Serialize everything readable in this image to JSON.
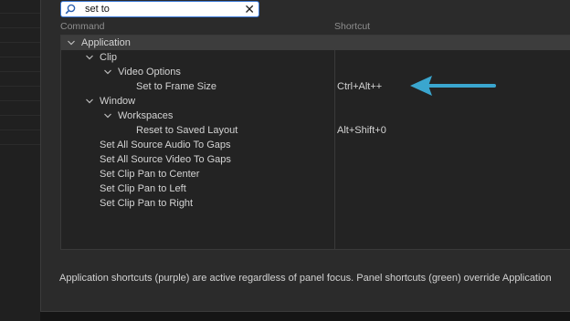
{
  "search": {
    "value": "set to",
    "placeholder": ""
  },
  "columns": {
    "command": "Command",
    "shortcut": "Shortcut"
  },
  "tree": [
    {
      "label": "Application",
      "shortcut": "",
      "depth": 0,
      "expandable": true,
      "selected": true
    },
    {
      "label": "Clip",
      "shortcut": "",
      "depth": 1,
      "expandable": true
    },
    {
      "label": "Video Options",
      "shortcut": "",
      "depth": 2,
      "expandable": true
    },
    {
      "label": "Set to Frame Size",
      "shortcut": "Ctrl+Alt++",
      "depth": 3,
      "expandable": false
    },
    {
      "label": "Window",
      "shortcut": "",
      "depth": 1,
      "expandable": true
    },
    {
      "label": "Workspaces",
      "shortcut": "",
      "depth": 2,
      "expandable": true
    },
    {
      "label": "Reset to Saved Layout",
      "shortcut": "Alt+Shift+0",
      "depth": 3,
      "expandable": false
    },
    {
      "label": "Set All Source Audio To Gaps",
      "shortcut": "",
      "depth": 1,
      "expandable": false
    },
    {
      "label": "Set All Source Video To Gaps",
      "shortcut": "",
      "depth": 1,
      "expandable": false
    },
    {
      "label": "Set Clip Pan to Center",
      "shortcut": "",
      "depth": 1,
      "expandable": false
    },
    {
      "label": "Set Clip Pan to Left",
      "shortcut": "",
      "depth": 1,
      "expandable": false
    },
    {
      "label": "Set Clip Pan to Right",
      "shortcut": "",
      "depth": 1,
      "expandable": false
    }
  ],
  "footer": "Application shortcuts (purple) are active regardless of panel focus. Panel shortcuts (green) override Application",
  "colors": {
    "arrow": "#3aa6cf",
    "search_border": "#3a78d6",
    "selected_row": "#3d3d3d"
  },
  "icons": {
    "search": "search-icon",
    "clear": "close-icon",
    "expand": "chevron-down-icon",
    "annotation": "arrow-left-icon"
  }
}
